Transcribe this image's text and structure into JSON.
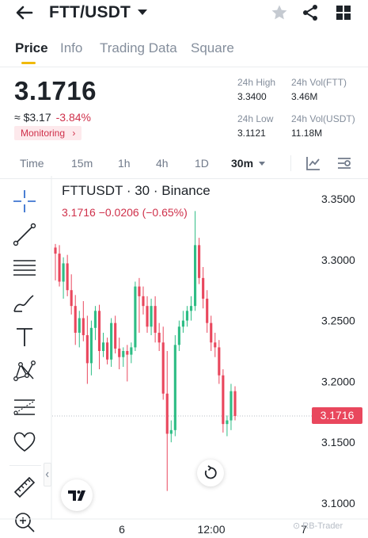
{
  "header": {
    "title": "FTT/USDT",
    "icons": [
      "back-arrow-icon",
      "caret-down-icon",
      "star-icon",
      "share-icon",
      "grid-icon"
    ]
  },
  "tabs": [
    {
      "label": "Price",
      "active": true
    },
    {
      "label": "Info",
      "active": false
    },
    {
      "label": "Trading Data",
      "active": false
    },
    {
      "label": "Square",
      "active": false
    }
  ],
  "ticker": {
    "price": "3.1716",
    "usd_price": "≈ $3.17",
    "change": "-3.84%",
    "monitoring": "Monitoring",
    "stats": [
      {
        "label": "24h High",
        "value": "3.3400"
      },
      {
        "label": "24h Vol(FTT)",
        "value": "3.46M"
      },
      {
        "label": "24h Low",
        "value": "3.1121"
      },
      {
        "label": "24h Vol(USDT)",
        "value": "11.18M"
      }
    ]
  },
  "intervals": [
    {
      "label": "Time",
      "active": false
    },
    {
      "label": "15m",
      "active": false
    },
    {
      "label": "1h",
      "active": false
    },
    {
      "label": "4h",
      "active": false
    },
    {
      "label": "1D",
      "active": false
    },
    {
      "label": "30m",
      "active": true
    }
  ],
  "chart": {
    "title": "FTTUSDT · 30 · Binance",
    "subtitle": "3.1716  −0.0206 (−0.65%)",
    "current_price_label": "3.1716",
    "watermark": "RB-Trader",
    "colors": {
      "up": "#2ebd85",
      "down": "#e9475d",
      "price_line": "#b7bdc6"
    }
  },
  "chart_data": {
    "type": "candlestick",
    "symbol": "FTTUSDT",
    "interval": "30",
    "exchange": "Binance",
    "y_ticks": [
      "3.3500",
      "3.3000",
      "3.2500",
      "3.2000",
      "3.1500",
      "3.1000"
    ],
    "x_ticks": [
      "6",
      "12:00",
      "7"
    ],
    "ylim": [
      3.09,
      3.36
    ],
    "current_price": 3.1716,
    "candles": [
      [
        3.31,
        3.313,
        3.283,
        3.305
      ],
      [
        3.305,
        3.312,
        3.278,
        3.282
      ],
      [
        3.282,
        3.302,
        3.268,
        3.297
      ],
      [
        3.297,
        3.304,
        3.27,
        3.275
      ],
      [
        3.275,
        3.288,
        3.255,
        3.262
      ],
      [
        3.262,
        3.271,
        3.23,
        3.24
      ],
      [
        3.24,
        3.258,
        3.228,
        3.252
      ],
      [
        3.252,
        3.266,
        3.233,
        3.238
      ],
      [
        3.238,
        3.254,
        3.198,
        3.215
      ],
      [
        3.215,
        3.25,
        3.205,
        3.244
      ],
      [
        3.244,
        3.262,
        3.234,
        3.258
      ],
      [
        3.258,
        3.263,
        3.21,
        3.225
      ],
      [
        3.225,
        3.24,
        3.22,
        3.232
      ],
      [
        3.232,
        3.236,
        3.214,
        3.218
      ],
      [
        3.218,
        3.252,
        3.212,
        3.248
      ],
      [
        3.248,
        3.254,
        3.223,
        3.227
      ],
      [
        3.227,
        3.236,
        3.21,
        3.22
      ],
      [
        3.22,
        3.228,
        3.212,
        3.225
      ],
      [
        3.225,
        3.23,
        3.2,
        3.222
      ],
      [
        3.222,
        3.232,
        3.215,
        3.228
      ],
      [
        3.228,
        3.282,
        3.225,
        3.278
      ],
      [
        3.278,
        3.285,
        3.24,
        3.27
      ],
      [
        3.27,
        3.278,
        3.255,
        3.262
      ],
      [
        3.262,
        3.27,
        3.24,
        3.245
      ],
      [
        3.245,
        3.268,
        3.238,
        3.262
      ],
      [
        3.262,
        3.27,
        3.232,
        3.24
      ],
      [
        3.24,
        3.248,
        3.225,
        3.232
      ],
      [
        3.232,
        3.245,
        3.185,
        3.19
      ],
      [
        3.19,
        3.225,
        3.11,
        3.157
      ],
      [
        3.157,
        3.168,
        3.15,
        3.16
      ],
      [
        3.16,
        3.238,
        3.155,
        3.23
      ],
      [
        3.23,
        3.25,
        3.225,
        3.245
      ],
      [
        3.245,
        3.258,
        3.24,
        3.25
      ],
      [
        3.25,
        3.262,
        3.245,
        3.258
      ],
      [
        3.258,
        3.27,
        3.25,
        3.262
      ],
      [
        3.262,
        3.34,
        3.258,
        3.312
      ],
      [
        3.312,
        3.318,
        3.28,
        3.285
      ],
      [
        3.285,
        3.294,
        3.26,
        3.268
      ],
      [
        3.268,
        3.275,
        3.24,
        3.248
      ],
      [
        3.248,
        3.254,
        3.225,
        3.232
      ],
      [
        3.232,
        3.24,
        3.22,
        3.228
      ],
      [
        3.228,
        3.234,
        3.198,
        3.205
      ],
      [
        3.205,
        3.21,
        3.158,
        3.165
      ],
      [
        3.165,
        3.172,
        3.155,
        3.168
      ],
      [
        3.168,
        3.198,
        3.16,
        3.192
      ],
      [
        3.192,
        3.196,
        3.168,
        3.1716
      ]
    ]
  }
}
